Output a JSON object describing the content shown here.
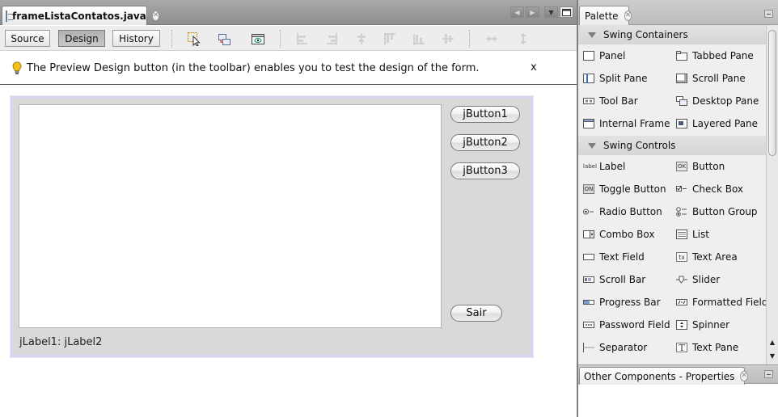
{
  "editor": {
    "file_tab": {
      "label": "frameListaContatos.java"
    },
    "views": {
      "source": "Source",
      "design": "Design",
      "history": "History"
    },
    "hint": {
      "text": "The Preview Design button (in the toolbar) enables you to test the design of the form.",
      "close": "x"
    }
  },
  "form": {
    "buttons": [
      "jButton1",
      "jButton2",
      "jButton3"
    ],
    "exit_button": "Sair",
    "labels": "jLabel1:  jLabel2"
  },
  "palette": {
    "title": "Palette",
    "categories": [
      {
        "label": "Swing Containers",
        "items": [
          {
            "label": "Panel",
            "icon": "panel-icon"
          },
          {
            "label": "Tabbed Pane",
            "icon": "tabbed-pane-icon"
          },
          {
            "label": "Split Pane",
            "icon": "split-pane-icon"
          },
          {
            "label": "Scroll Pane",
            "icon": "scroll-pane-icon"
          },
          {
            "label": "Tool Bar",
            "icon": "tool-bar-icon"
          },
          {
            "label": "Desktop Pane",
            "icon": "desktop-pane-icon"
          },
          {
            "label": "Internal Frame",
            "icon": "internal-frame-icon"
          },
          {
            "label": "Layered Pane",
            "icon": "layered-pane-icon"
          }
        ]
      },
      {
        "label": "Swing Controls",
        "items": [
          {
            "label": "Label",
            "icon": "label-icon"
          },
          {
            "label": "Button",
            "icon": "button-icon"
          },
          {
            "label": "Toggle Button",
            "icon": "toggle-button-icon"
          },
          {
            "label": "Check Box",
            "icon": "check-box-icon"
          },
          {
            "label": "Radio Button",
            "icon": "radio-button-icon"
          },
          {
            "label": "Button Group",
            "icon": "button-group-icon"
          },
          {
            "label": "Combo Box",
            "icon": "combo-box-icon"
          },
          {
            "label": "List",
            "icon": "list-icon"
          },
          {
            "label": "Text Field",
            "icon": "text-field-icon"
          },
          {
            "label": "Text Area",
            "icon": "text-area-icon"
          },
          {
            "label": "Scroll Bar",
            "icon": "scroll-bar-icon"
          },
          {
            "label": "Slider",
            "icon": "slider-icon"
          },
          {
            "label": "Progress Bar",
            "icon": "progress-bar-icon"
          },
          {
            "label": "Formatted Field",
            "icon": "formatted-field-icon"
          },
          {
            "label": "Password Field",
            "icon": "password-field-icon"
          },
          {
            "label": "Spinner",
            "icon": "spinner-icon"
          },
          {
            "label": "Separator",
            "icon": "separator-icon"
          },
          {
            "label": "Text Pane",
            "icon": "text-pane-icon"
          }
        ]
      }
    ],
    "icon_text": {
      "label": "label",
      "button": "OK",
      "toggle": "ON",
      "text_area": "tx",
      "text_pane": "T"
    }
  },
  "properties": {
    "title": "Other Components - Properties"
  },
  "colors": {
    "selected_view": "#b8b8b8",
    "form_background": "#d9d9d9",
    "form_border": "#d6d6f0"
  }
}
